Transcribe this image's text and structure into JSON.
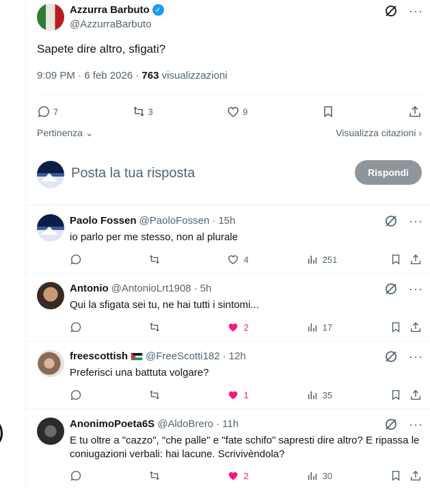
{
  "tweet": {
    "author_name": "Azzurra Barbuto",
    "author_handle": "@AzzurraBarbuto",
    "text": "Sapete dire altro, sfigati?",
    "time": "9:09 PM · 6 feb 2026 · ",
    "views_count": "763",
    "views_label": " visualizzazioni",
    "replies": "7",
    "reposts": "3",
    "likes": "9"
  },
  "sort": {
    "relevance_label": "Pertinenza",
    "quotes_label": "Visualizza citazioni"
  },
  "composer": {
    "placeholder": "Posta la tua risposta",
    "reply_button": "Rispondi"
  },
  "replies": [
    {
      "name": "Paolo Fossen",
      "handle": "@PaoloFossen",
      "time": "15h",
      "text": "io parlo per me stesso, non al plurale",
      "likes": "4",
      "liked": false,
      "views": "251"
    },
    {
      "name": "Antonio",
      "handle": "@AntonioLrt1908",
      "time": "5h",
      "text": "Qui la sfigata sei tu, ne hai tutti i sintomi...",
      "likes": "2",
      "liked": true,
      "views": "17"
    },
    {
      "name": "freescottish",
      "handle": "@FreeScotti182",
      "time": "12h",
      "text": "Preferisci una battuta volgare?",
      "likes": "1",
      "liked": true,
      "views": "35"
    },
    {
      "name": "AnonimoPoeta6S",
      "handle": "@AldoBrero",
      "time": "11h",
      "text": "E tu oltre a \"cazzo\", \"che palle\" e \"fate schifo\" sapresti dire altro? E ripassa le coniugazioni verbali: hai lacune. Scrivivèndola?",
      "likes": "2",
      "liked": true,
      "views": "30"
    }
  ],
  "colors": {
    "accent": "#1d9bf0",
    "like": "#f91880",
    "muted": "#536471",
    "reply_button_bg": "#8f969b"
  }
}
